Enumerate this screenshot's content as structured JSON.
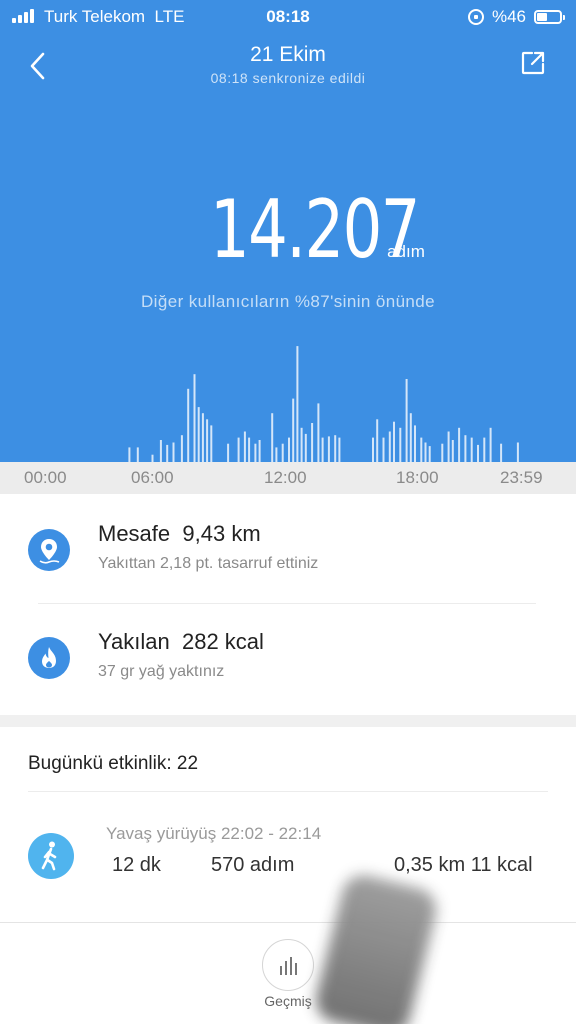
{
  "status_bar": {
    "carrier": "Turk Telekom",
    "network": "LTE",
    "time": "08:18",
    "battery_label": "%46",
    "battery_level": 0.46
  },
  "nav": {
    "title": "21 Ekim",
    "subtitle": "08:18 senkronize edildi",
    "back_icon": "chevron-left-icon",
    "share_icon": "share-icon"
  },
  "summary": {
    "steps": "14.207",
    "steps_unit": "adım",
    "rank_text": "Diğer kullanıcıların %87'sinin önünde"
  },
  "time_axis": [
    "00:00",
    "06:00",
    "12:00",
    "18:00",
    "23:59"
  ],
  "chart_data": {
    "type": "bar",
    "x_range": [
      0,
      24
    ],
    "bars": [
      [
        4.4,
        0.12
      ],
      [
        4.8,
        0.12
      ],
      [
        5.5,
        0.06
      ],
      [
        5.9,
        0.18
      ],
      [
        6.2,
        0.14
      ],
      [
        6.5,
        0.16
      ],
      [
        6.9,
        0.22
      ],
      [
        7.2,
        0.6
      ],
      [
        7.5,
        0.72
      ],
      [
        7.7,
        0.45
      ],
      [
        7.9,
        0.4
      ],
      [
        8.1,
        0.35
      ],
      [
        8.3,
        0.3
      ],
      [
        9.1,
        0.15
      ],
      [
        9.6,
        0.2
      ],
      [
        9.9,
        0.25
      ],
      [
        10.1,
        0.2
      ],
      [
        10.4,
        0.15
      ],
      [
        10.6,
        0.18
      ],
      [
        11.2,
        0.4
      ],
      [
        11.4,
        0.12
      ],
      [
        11.7,
        0.15
      ],
      [
        12.0,
        0.2
      ],
      [
        12.2,
        0.52
      ],
      [
        12.4,
        0.95
      ],
      [
        12.6,
        0.28
      ],
      [
        12.8,
        0.23
      ],
      [
        13.1,
        0.32
      ],
      [
        13.4,
        0.48
      ],
      [
        13.6,
        0.2
      ],
      [
        13.9,
        0.21
      ],
      [
        14.2,
        0.22
      ],
      [
        14.4,
        0.2
      ],
      [
        16.0,
        0.2
      ],
      [
        16.2,
        0.35
      ],
      [
        16.5,
        0.2
      ],
      [
        16.8,
        0.25
      ],
      [
        17.0,
        0.33
      ],
      [
        17.3,
        0.28
      ],
      [
        17.6,
        0.68
      ],
      [
        17.8,
        0.4
      ],
      [
        18.0,
        0.3
      ],
      [
        18.3,
        0.2
      ],
      [
        18.5,
        0.16
      ],
      [
        18.7,
        0.13
      ],
      [
        19.3,
        0.15
      ],
      [
        19.6,
        0.25
      ],
      [
        19.8,
        0.18
      ],
      [
        20.1,
        0.28
      ],
      [
        20.4,
        0.22
      ],
      [
        20.7,
        0.2
      ],
      [
        21.0,
        0.14
      ],
      [
        21.3,
        0.2
      ],
      [
        21.6,
        0.28
      ],
      [
        22.1,
        0.15
      ],
      [
        22.9,
        0.16
      ]
    ]
  },
  "distance": {
    "label": "Mesafe",
    "value": "9,43 km",
    "sub": "Yakıttan 2,18 pt. tasarruf ettiniz",
    "icon": "map-pin-icon"
  },
  "calories": {
    "label": "Yakılan",
    "value": "282 kcal",
    "sub": "37 gr yağ yaktınız",
    "icon": "flame-icon"
  },
  "activity": {
    "header": "Bugünkü etkinlik: 22",
    "item": {
      "title": "Yavaş yürüyüş 22:02 - 22:14",
      "duration": "12  dk",
      "steps": "570 adım",
      "distance_cal": "0,35 km 11 kcal",
      "icon": "walking-person-icon"
    }
  },
  "bottom": {
    "history_label": "Geçmiş",
    "history_icon": "bar-chart-icon"
  },
  "colors": {
    "primary": "#3d8fe3",
    "walk_icon_bg": "#50b4ee"
  }
}
